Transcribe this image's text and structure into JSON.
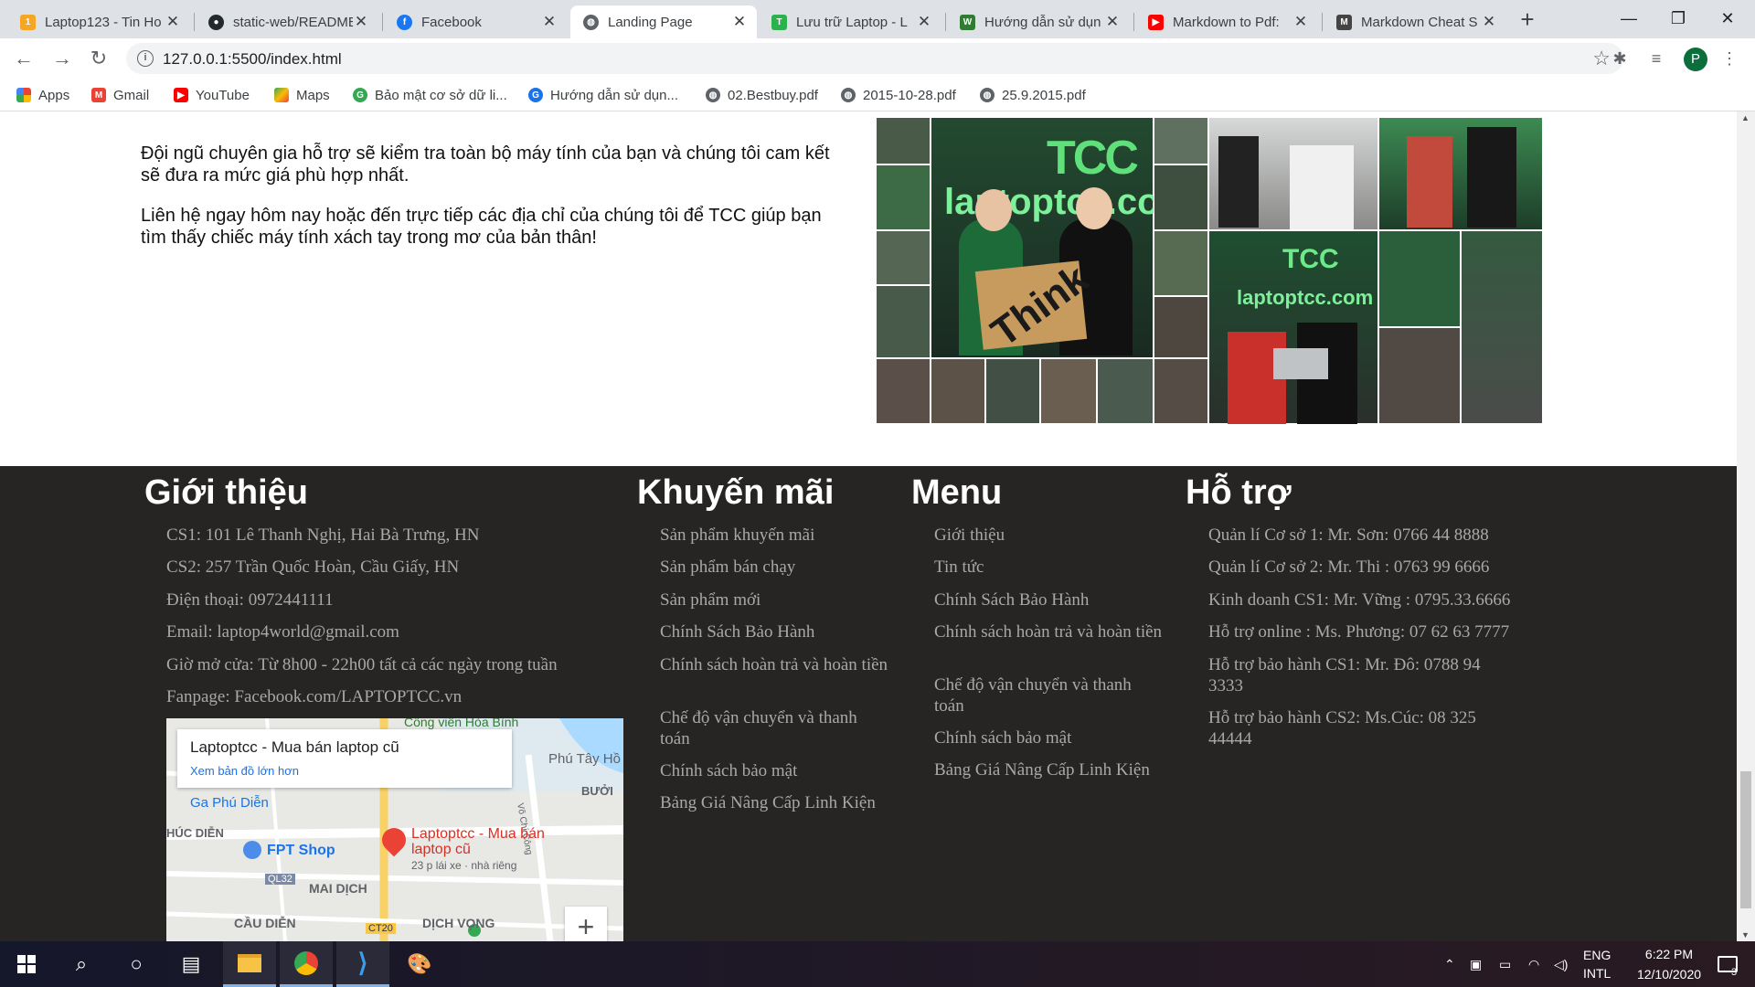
{
  "browser": {
    "tabs": [
      {
        "title": "Laptop123 - Tin Ho",
        "icon": "laptop123-icon",
        "color": "#f5a623"
      },
      {
        "title": "static-web/README",
        "icon": "github-icon",
        "color": "#24292e"
      },
      {
        "title": "Facebook",
        "icon": "facebook-icon",
        "color": "#1877f2"
      },
      {
        "title": "Landing Page",
        "icon": "globe-icon",
        "color": "#5f6368",
        "active": true
      },
      {
        "title": "Lưu trữ Laptop - L",
        "icon": "laptoptcc-icon",
        "color": "#2bb24c"
      },
      {
        "title": "Hướng dẫn sử dụn",
        "icon": "wp-icon",
        "color": "#2e7d32"
      },
      {
        "title": "Markdown to Pdf:",
        "icon": "youtube-icon",
        "color": "#ff0000"
      },
      {
        "title": "Markdown Cheat S",
        "icon": "markdown-icon",
        "color": "#444444"
      }
    ],
    "url": "127.0.0.1:5500/index.html",
    "profile_initial": "P",
    "bookmarks": [
      {
        "label": "Apps",
        "icon": "apps-grid-icon",
        "color": "#4285f4"
      },
      {
        "label": "Gmail",
        "icon": "gmail-icon",
        "color": "#ea4335"
      },
      {
        "label": "YouTube",
        "icon": "youtube-icon",
        "color": "#ff0000"
      },
      {
        "label": "Maps",
        "icon": "maps-icon",
        "color": "#34a853"
      },
      {
        "label": "Bảo mật cơ sở dữ li...",
        "icon": "g-green-icon",
        "color": "#34a853"
      },
      {
        "label": "Hướng dẫn sử dụn...",
        "icon": "g-blue-icon",
        "color": "#1a73e8"
      },
      {
        "label": "02.Bestbuy.pdf",
        "icon": "globe-icon",
        "color": "#5f6368"
      },
      {
        "label": "2015-10-28.pdf",
        "icon": "globe-icon",
        "color": "#5f6368"
      },
      {
        "label": "25.9.2015.pdf",
        "icon": "globe-icon",
        "color": "#5f6368"
      }
    ]
  },
  "content": {
    "paragraph1": "Đội ngũ chuyên gia hỗ trợ sẽ kiểm tra toàn bộ máy tính của bạn và chúng tôi cam kết sẽ đưa ra mức giá phù hợp nhất.",
    "paragraph2": "Liên hệ ngay hôm nay hoặc đến trực tiếp các địa chỉ của chúng tôi để TCC giúp bạn tìm thấy chiếc máy tính xách tay trong mơ của bản thân!",
    "collage_logo": "TCC",
    "collage_sign": "laptoptcc.com",
    "collage_box": "Think"
  },
  "footer": {
    "intro": {
      "heading": "Giới thiệu",
      "lines": [
        "CS1: 101 Lê Thanh Nghị, Hai Bà Trưng, HN",
        "CS2: 257 Trần Quốc Hoàn, Cầu Giấy, HN",
        "Điện thoại: 0972441111",
        "Email: laptop4world@gmail.com",
        "Giờ mở cửa: Từ 8h00 - 22h00 tất cả các ngày trong tuần",
        "Fanpage: Facebook.com/LAPTOPTCC.vn"
      ]
    },
    "promo": {
      "heading": "Khuyến mãi",
      "links": [
        "Sản phẩm khuyến mãi",
        "Sản phẩm bán chạy",
        "Sản phẩm mới",
        "Chính Sách Bảo Hành",
        "Chính sách hoàn trả và hoàn tiền",
        "Chế độ vận chuyển và thanh toán",
        "Chính sách bảo mật",
        "Bảng Giá Nâng Cấp Linh Kiện"
      ]
    },
    "menu": {
      "heading": "Menu",
      "links": [
        "Giới thiệu",
        "Tin tức",
        "Chính Sách Bảo Hành",
        "Chính sách hoàn trả và hoàn tiền",
        "Chế độ vận chuyển và thanh toán",
        "Chính sách bảo mật",
        "Bảng Giá Nâng Cấp Linh Kiện"
      ]
    },
    "support": {
      "heading": "Hỗ trợ",
      "lines": [
        "Quản lí Cơ sở 1: Mr. Sơn: 0766 44 8888",
        "Quản lí Cơ sở 2: Mr. Thi : 0763 99 6666",
        "Kinh doanh CS1: Mr. Vững : 0795.33.6666",
        "Hỗ trợ online : Ms. Phương: 07 62 63 7777",
        "Hỗ trợ bảo hành CS1: Mr. Đô: 0788 94 3333",
        "Hỗ trợ bảo hành CS2: Ms.Cúc: 08 325 44444"
      ]
    },
    "map": {
      "place_name": "Laptoptcc - Mua bán laptop cũ",
      "larger_map_link": "Xem bản đồ lớn hơn",
      "pin_label": "Laptoptcc - Mua bán laptop cũ",
      "pin_sub": "23 p lái xe · nhà riêng",
      "labels": [
        "Công viên Hòa Bình",
        "Phú Tây Hồ",
        "BƯỞI",
        "Ga Phú Diễn",
        "HÚC DIỄN",
        "FPT Shop",
        "QL32",
        "MAI DỊCH",
        "CẦU DIỄN",
        "CT20",
        "DỊCH VỌNG",
        "Võ Chí Công"
      ],
      "zoom_in": "+"
    }
  },
  "taskbar": {
    "language": "ENG",
    "layout": "INTL",
    "time": "6:22 PM",
    "date": "12/10/2020",
    "notification_count": "3"
  }
}
